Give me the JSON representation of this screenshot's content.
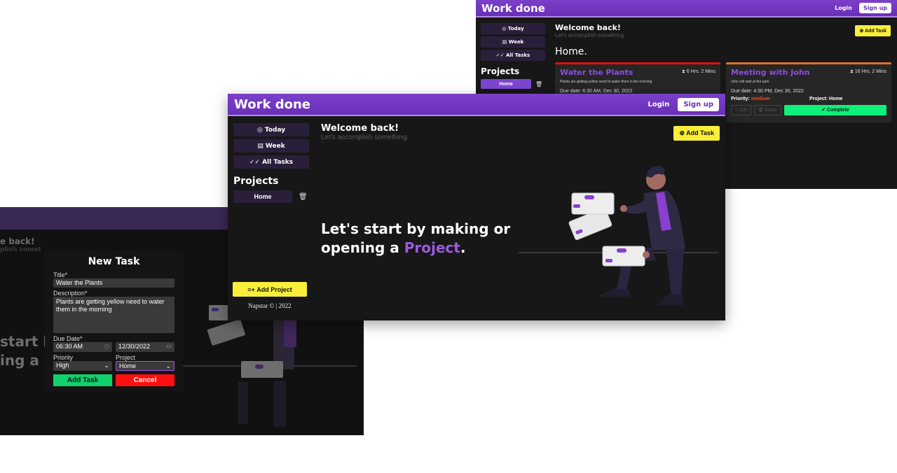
{
  "colors": {
    "header": "#7b3fc9",
    "accent": "#9c5be0",
    "yellow": "#f9ef3a",
    "green": "#0df07a",
    "red": "#ff1010",
    "bg": "#171717"
  },
  "app": {
    "brand": "Work done",
    "login": "Login",
    "signup": "Sign up"
  },
  "sidebar": {
    "items": [
      {
        "icon": "target-icon",
        "label": "Today"
      },
      {
        "icon": "calendar-icon",
        "label": "Week"
      },
      {
        "icon": "double-check-icon",
        "label": "All Tasks"
      }
    ],
    "projects_title": "Projects",
    "projects": [
      {
        "label": "Home"
      }
    ],
    "add_project": "Add Project",
    "footer": "Napstar © | 2022"
  },
  "welcome": {
    "title": "Welcome back!",
    "subtitle": "Let's accomplish something."
  },
  "add_task": "Add Task",
  "empty_state": {
    "line1": "Let's start by making or",
    "line2_prefix": "opening a ",
    "line2_accent": "Project",
    "line2_suffix": "."
  },
  "project_view": {
    "heading": "Home.",
    "tasks": [
      {
        "title": "Water the Plants",
        "time_left": "6 Hrs. 2 Mins",
        "description": "Plants are getting yellow need to water them in the morning",
        "due": "Due date: 6:30 AM, Dec 30, 2022",
        "border_color": "#e01010"
      },
      {
        "title": "Meeting with John",
        "time_left": "16 Hrs. 2 Mins",
        "description": "John will wait at the park",
        "due": "Due date: 4:30 PM, Dec 30, 2022",
        "priority_label": "Priority: ",
        "priority_value": "medium",
        "project": "Project: Home",
        "edit": "Edit",
        "delete": "Delete",
        "complete": "Complete",
        "border_color": "#e0702a"
      }
    ]
  },
  "dim_screen": {
    "welcome_partial": "e back!",
    "sub_partial": "plish somet",
    "sub_tail": "ing",
    "hero1_partial": "start b",
    "hero2_partial": "ing a ",
    "hero2_accent_partial": "P"
  },
  "new_task_modal": {
    "title": "New Task",
    "title_label": "Title*",
    "title_value": "Water the Plants",
    "description_label": "Description*",
    "description_value": "Plants are getting yellow need to water them in the morning",
    "due_label": "Due Date*",
    "time_value": "06:30 AM",
    "date_value": "12/30/2022",
    "priority_label": "Priority",
    "priority_value": "High",
    "project_label": "Project",
    "project_value": "Home",
    "add_button": "Add Task",
    "cancel_button": "Cancel"
  }
}
